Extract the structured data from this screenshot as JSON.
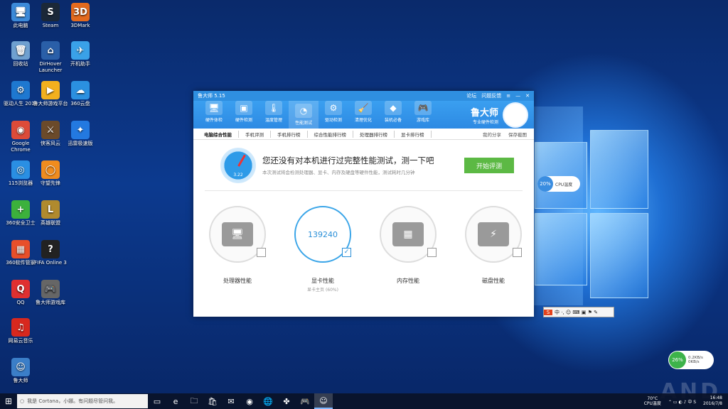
{
  "desktop": {
    "icons": [
      {
        "label": "此电脑",
        "glyph": "🖥",
        "color": "#3c8ad8"
      },
      {
        "label": "Steam",
        "glyph": "S",
        "color": "#1b2838"
      },
      {
        "label": "3DMark",
        "glyph": "3D",
        "color": "#e36a1e"
      },
      {
        "label": "回收站",
        "glyph": "🗑",
        "color": "#6fa0d0"
      },
      {
        "label": "DirHover Launcher",
        "glyph": "⌂",
        "color": "#2a5fa8"
      },
      {
        "label": "开机助手",
        "glyph": "✈",
        "color": "#3aa1e8"
      },
      {
        "label": "驱动人生 2018",
        "glyph": "⚙",
        "color": "#1e78d0"
      },
      {
        "label": "鲁大师游戏平台",
        "glyph": "▶",
        "color": "#f2b01e"
      },
      {
        "label": "360云盘",
        "glyph": "☁",
        "color": "#2b90e0"
      },
      {
        "label": "Google Chrome",
        "glyph": "◉",
        "color": "#dd4b39"
      },
      {
        "label": "侠客风云",
        "glyph": "⚔",
        "color": "#6b4a2a"
      },
      {
        "label": "迅雷极速版",
        "glyph": "✦",
        "color": "#2379e0"
      },
      {
        "label": "115浏览器",
        "glyph": "◎",
        "color": "#2a8fe3"
      },
      {
        "label": "守望先锋",
        "glyph": "◯",
        "color": "#f08c1e"
      },
      {
        "label": "360安全卫士",
        "glyph": "+",
        "color": "#3cb13c"
      },
      {
        "label": "英雄联盟",
        "glyph": "L",
        "color": "#b08a2e"
      },
      {
        "label": "360软件管家",
        "glyph": "▦",
        "color": "#e84f2a"
      },
      {
        "label": "FIFA Online 3",
        "glyph": "?",
        "color": "#222"
      },
      {
        "label": "QQ",
        "glyph": "Q",
        "color": "#e03030"
      },
      {
        "label": "鲁大师游戏库",
        "glyph": "🎮",
        "color": "#666"
      },
      {
        "label": "网易云音乐",
        "glyph": "♫",
        "color": "#d8281e"
      },
      {
        "label": "鲁大师",
        "glyph": "☺",
        "color": "#3b7ec8"
      }
    ]
  },
  "app": {
    "title": "鲁大师 5.15",
    "title_links": [
      "论坛",
      "问题反馈"
    ],
    "window_controls": [
      "≡",
      "—",
      "✕"
    ],
    "tools": [
      {
        "label": "硬件体检",
        "glyph": "🖥"
      },
      {
        "label": "硬件检测",
        "glyph": "▣"
      },
      {
        "label": "温度管理",
        "glyph": "🌡"
      },
      {
        "label": "性能测试",
        "glyph": "◔"
      },
      {
        "label": "驱动检测",
        "glyph": "⚙"
      },
      {
        "label": "清理优化",
        "glyph": "🧹"
      },
      {
        "label": "装机必备",
        "glyph": "◆"
      },
      {
        "label": "游戏库",
        "glyph": "🎮"
      }
    ],
    "active_tool": 3,
    "brand_name": "鲁大师",
    "brand_slogan": "专业硬件检测",
    "subtabs": [
      "电脑综合性能",
      "手机评测",
      "手机排行榜",
      "综合性能排行榜",
      "处理器排行榜",
      "显卡排行榜"
    ],
    "subtab_right": [
      "我的分享",
      "保存截图"
    ],
    "banner_headline": "您还没有对本机进行过完整性能测试，测一下吧",
    "banner_subline": "本次测试将会检测处理器、显卡、内存及硬盘等硬件性能，测试耗时几分钟",
    "gauge_value": "3.22",
    "start_button": "开始评测",
    "cards": [
      {
        "label": "处理器性能",
        "sub": "",
        "score": "",
        "glyph": "🖥",
        "checked": false
      },
      {
        "label": "显卡性能",
        "sub": "显卡主页 (60%)",
        "score": "139240",
        "glyph": "",
        "checked": true
      },
      {
        "label": "内存性能",
        "sub": "",
        "score": "",
        "glyph": "▦",
        "checked": false
      },
      {
        "label": "磁盘性能",
        "sub": "",
        "score": "",
        "glyph": "⚡",
        "checked": false
      }
    ]
  },
  "widgets": {
    "cpu_value": "20%",
    "cpu_label": "CPU温度",
    "net_value": "26%",
    "net_up": "0.2KB/s",
    "net_down": "0KB/s",
    "ime_logo": "S",
    "ime_text": "中 ·, ☺ ⌨ ▣ ⚑ ✎"
  },
  "taskbar": {
    "search_placeholder": "我是 Cortana，小娜。有问题尽管问我。",
    "apps": [
      "▭",
      "e",
      "🗀",
      "🛍",
      "✉",
      "◉",
      "🌐",
      "✤",
      "🎮",
      "☺"
    ],
    "active_app": 9,
    "sys_label_1": "70°C",
    "sys_label_2": "CPU温度",
    "time": "16:48",
    "date": "2016/7/8",
    "watermark": "AND"
  }
}
